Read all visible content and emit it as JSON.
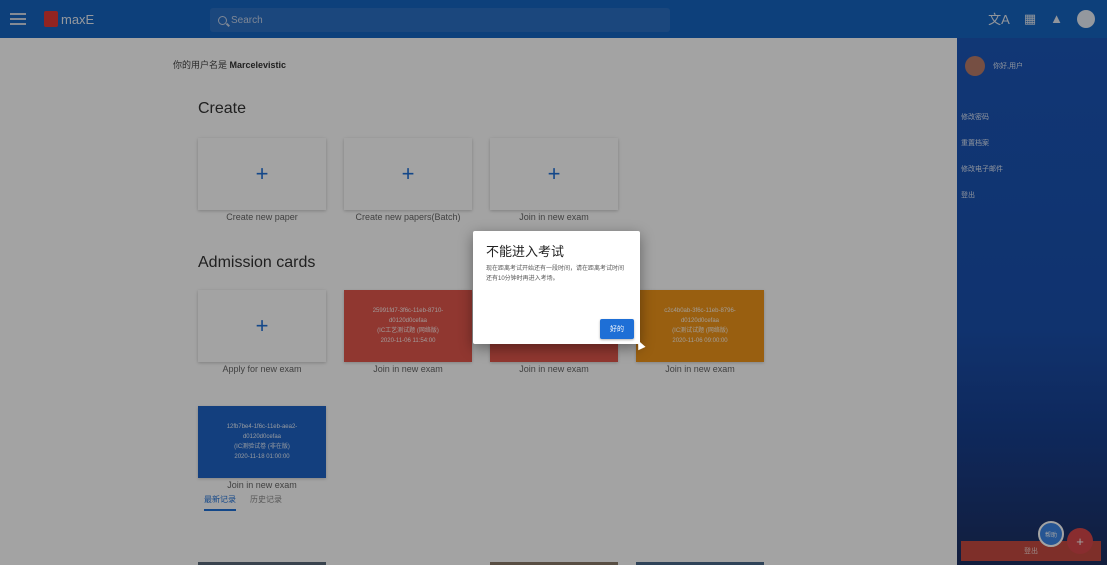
{
  "topbar": {
    "app_name": "maxE",
    "search_placeholder": "Search",
    "translate_glyph": "文A",
    "apps_glyph": "▦",
    "bell_glyph": "▲"
  },
  "main": {
    "username_prefix": "你的用户名是 ",
    "username": "Marcelevistic",
    "create_title": "Create",
    "create_cards": [
      {
        "label": "Create new paper"
      },
      {
        "label": "Create new papers(Batch)"
      },
      {
        "label": "Join in new exam"
      }
    ],
    "admission_title": "Admission cards",
    "apply_label": "Apply for new exam",
    "exam_cards": [
      {
        "id_line1": "25991fd7-3f6c-11eb-8710-",
        "id_line2": "d0120d0cefaa",
        "name": "(IC工艺测试题 (网络版)",
        "time": "2020-11-06 11:54:00",
        "label": "Join in new exam",
        "color": "#e2574c"
      },
      {
        "id_line1": "",
        "id_line2": "",
        "name": "",
        "time": "",
        "label": "Join in new exam",
        "color": "#e2574c"
      },
      {
        "id_line1": "c2c4b0ab-3f6c-11eb-8796-",
        "id_line2": "d0120d0cefaa",
        "name": "(IC测试试题 (网络版)",
        "time": "2020-11-06 09:00:00",
        "label": "Join in new exam",
        "color": "#f0951a"
      },
      {
        "id_line1": "12fb7be4-1f6c-11eb-aea2-",
        "id_line2": "d0120d0cefaa",
        "name": "(IC测验试卷 (非在版)",
        "time": "2020-11-18 01:00:00",
        "label": "Join in new exam",
        "color": "#1e63c5"
      }
    ],
    "tabs": [
      "最新记录",
      "历史记录"
    ],
    "play_icon": "▶"
  },
  "sidebar": {
    "user_name": "你好,用户",
    "links": [
      "修改密码",
      "重置档案",
      "修改电子邮件",
      "登出"
    ],
    "logout_label": "登出"
  },
  "fab": {
    "blue_label": "帮助",
    "red_label": "+"
  },
  "dialog": {
    "title": "不能进入考试",
    "body": "现在距离考试开始还有一段时间，请在距离考试时间还有10分钟时再进入考场。",
    "ok_label": "好的"
  }
}
